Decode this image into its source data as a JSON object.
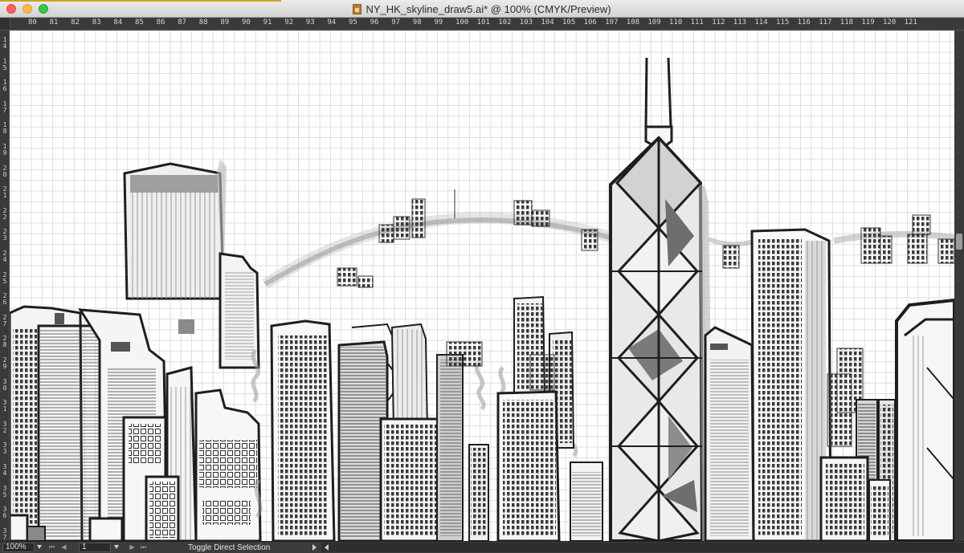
{
  "window": {
    "title": "NY_HK_skyline_draw5.ai* @ 100% (CMYK/Preview)",
    "buttons": {
      "close": "close",
      "minimize": "minimize",
      "zoom": "zoom"
    }
  },
  "ruler": {
    "horizontal_labels": [
      "80",
      "81",
      "82",
      "83",
      "84",
      "85",
      "86",
      "87",
      "88",
      "89",
      "90",
      "91",
      "92",
      "93",
      "94",
      "95",
      "96",
      "97",
      "98",
      "99",
      "100",
      "101",
      "102",
      "103",
      "104",
      "105",
      "106",
      "107",
      "108",
      "109",
      "110",
      "111",
      "112",
      "113",
      "114",
      "115",
      "116",
      "117",
      "118",
      "119",
      "120",
      "121"
    ],
    "vertical_labels": [
      "14",
      "15",
      "16",
      "17",
      "18",
      "19",
      "20",
      "21",
      "22",
      "23",
      "24",
      "25",
      "26",
      "27",
      "28",
      "29",
      "30",
      "31",
      "32",
      "33",
      "34",
      "35",
      "36",
      "37"
    ]
  },
  "status_bar": {
    "zoom_value": "100%",
    "page_value": "1",
    "tool_status": "Toggle Direct Selection"
  },
  "artwork": {
    "description_icon": "skyline-artwork",
    "stroke_color": "#1e1e1e",
    "fill_gray": "#8a8a8a",
    "wash_gray": "#a9a9a9"
  },
  "colors": {
    "close": "#fc605b",
    "minimize": "#fdbc40",
    "zoom": "#34c84a",
    "ruler_bg": "#3a3a3a",
    "canvas_grid": "#d9dde2"
  }
}
